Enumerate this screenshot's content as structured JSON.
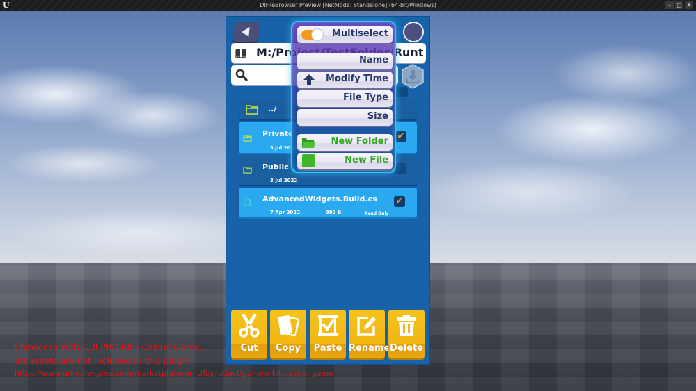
{
  "window": {
    "title": "DIFileBrowser Preview [NetMode: Standalone]  (64-bit/Windows)",
    "controls": {
      "minimize": "–",
      "maximize": "□",
      "close": "X"
    }
  },
  "header": {
    "path": "M:/Project/TestFolder/Runtime/",
    "search_placeholder": "",
    "search_value": ""
  },
  "menu": {
    "multiselect_label": "Multiselect",
    "multiselect_on": true,
    "sort_items": [
      {
        "label": "Name",
        "icon": "none"
      },
      {
        "label": "Modify Time",
        "icon": "arrow-up-icon"
      },
      {
        "label": "File Type",
        "icon": "none"
      },
      {
        "label": "Size",
        "icon": "none"
      }
    ],
    "create_items": [
      {
        "label": "New Folder",
        "icon": "folder-icon"
      },
      {
        "label": "New File",
        "icon": "file-icon"
      }
    ],
    "accent_color": "#37c3f5",
    "create_color": "#33a520"
  },
  "files": [
    {
      "name": "../",
      "type": "folder",
      "date": "",
      "size": "",
      "attr": "",
      "selected": false,
      "checked": false
    },
    {
      "name": "Private",
      "type": "folder",
      "date": "3 Jul 2022",
      "size": "",
      "attr": "",
      "selected": true,
      "checked": true
    },
    {
      "name": "Public",
      "type": "folder",
      "date": "3 Jul 2022",
      "size": "",
      "attr": "",
      "selected": false,
      "checked": false
    },
    {
      "name": "AdvancedWidgets.Build.cs",
      "type": "file",
      "date": "7 Apr 2022",
      "size": "392 B",
      "attr": "Read Only",
      "selected": true,
      "checked": true
    }
  ],
  "actions": [
    {
      "label": "Cut",
      "icon": "scissors-icon"
    },
    {
      "label": "Copy",
      "icon": "copy-icon"
    },
    {
      "label": "Paste",
      "icon": "paste-icon"
    },
    {
      "label": "Rename",
      "icon": "rename-icon"
    },
    {
      "label": "Delete",
      "icon": "trash-icon"
    }
  ],
  "overlay": {
    "line1": "Showcase with GUI PRO Kit - Casual Game,",
    "line2": "art assets are not included in this plugin",
    "line3": "https://www.unrealengine.com/marketplace/en-US/product/gui-pro-kit-casual-game"
  },
  "colors": {
    "panel": "#1762a8",
    "row_selected": "#2aa8f0",
    "action_button": "#f2b714",
    "checkmark": "#f39a1e",
    "overlay_text": "#e01818"
  }
}
